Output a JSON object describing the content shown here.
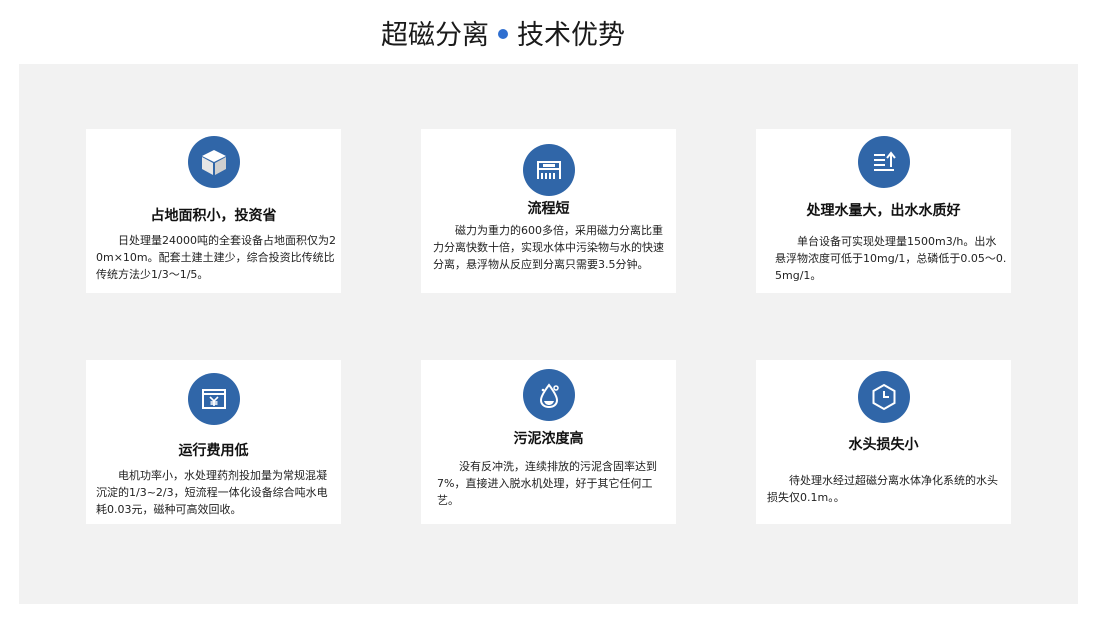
{
  "header": {
    "title_left": "超磁分离",
    "title_right": "技术优势"
  },
  "cards": [
    {
      "icon": "cube-icon",
      "title": "占地面积小，投资省",
      "text": "日处理量24000吨的全套设备占地面积仅为20m×10m。配套土建土建少，综合投资比传统比传统方法少1/3～1/5。"
    },
    {
      "icon": "process-icon",
      "title": "流程短",
      "text": "磁力为重力的600多倍，采用磁力分离比重力分离快数十倍，实现水体中污染物与水的快速分离，悬浮物从反应到分离只需要3.5分钟。"
    },
    {
      "icon": "list-upload-icon",
      "title": "处理水量大，出水水质好",
      "text": "单台设备可实现处理量1500m3/h。出水悬浮物浓度可低于10mg/1，总磷低于0.05～0.5mg/1。"
    },
    {
      "icon": "yen-card-icon",
      "title": "运行费用低",
      "text": "电机功率小，水处理药剂投加量为常规混凝沉淀的1/3~2/3，短流程一体化设备综合吨水电耗0.03元，磁种可高效回收。"
    },
    {
      "icon": "water-drop-icon",
      "title": "污泥浓度高",
      "text": "没有反冲洗，连续排放的污泥含固率达到7%，直接进入脱水机处理，好于其它任何工艺。"
    },
    {
      "icon": "clock-icon",
      "title": "水头损失小",
      "text": "待处理水经过超磁分离水体净化系统的水头损失仅0.1m。。"
    }
  ]
}
